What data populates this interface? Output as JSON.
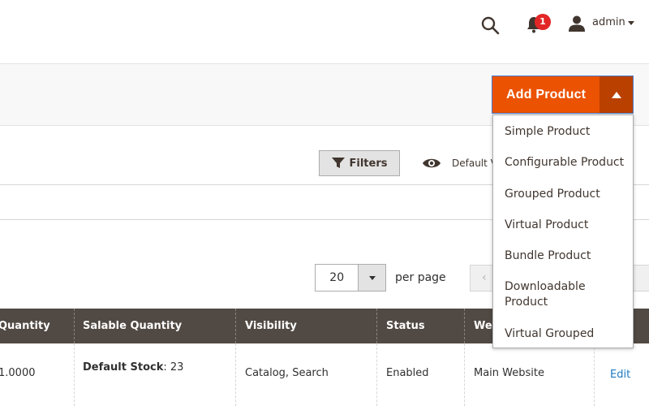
{
  "header": {
    "notifications_count": "1",
    "user_name": "admin"
  },
  "actions": {
    "add_product_label": "Add Product",
    "menu": [
      "Simple Product",
      "Configurable Product",
      "Grouped Product",
      "Virtual Product",
      "Bundle Product",
      "Downloadable Product",
      "Virtual Grouped"
    ]
  },
  "toolbar": {
    "filters_label": "Filters",
    "view_label": "Default View"
  },
  "pager": {
    "per_page_value": "20",
    "per_page_label": "per page",
    "prev_symbol": "‹"
  },
  "grid": {
    "columns": [
      "Quantity",
      "Salable Quantity",
      "Visibility",
      "Status",
      "Websites",
      ""
    ],
    "rows": [
      {
        "quantity": "1.0000",
        "salable_source": "Default Stock",
        "salable_value": ": 23",
        "visibility": "Catalog, Search",
        "status": "Enabled",
        "websites": "Main Website",
        "action": "Edit"
      }
    ]
  }
}
